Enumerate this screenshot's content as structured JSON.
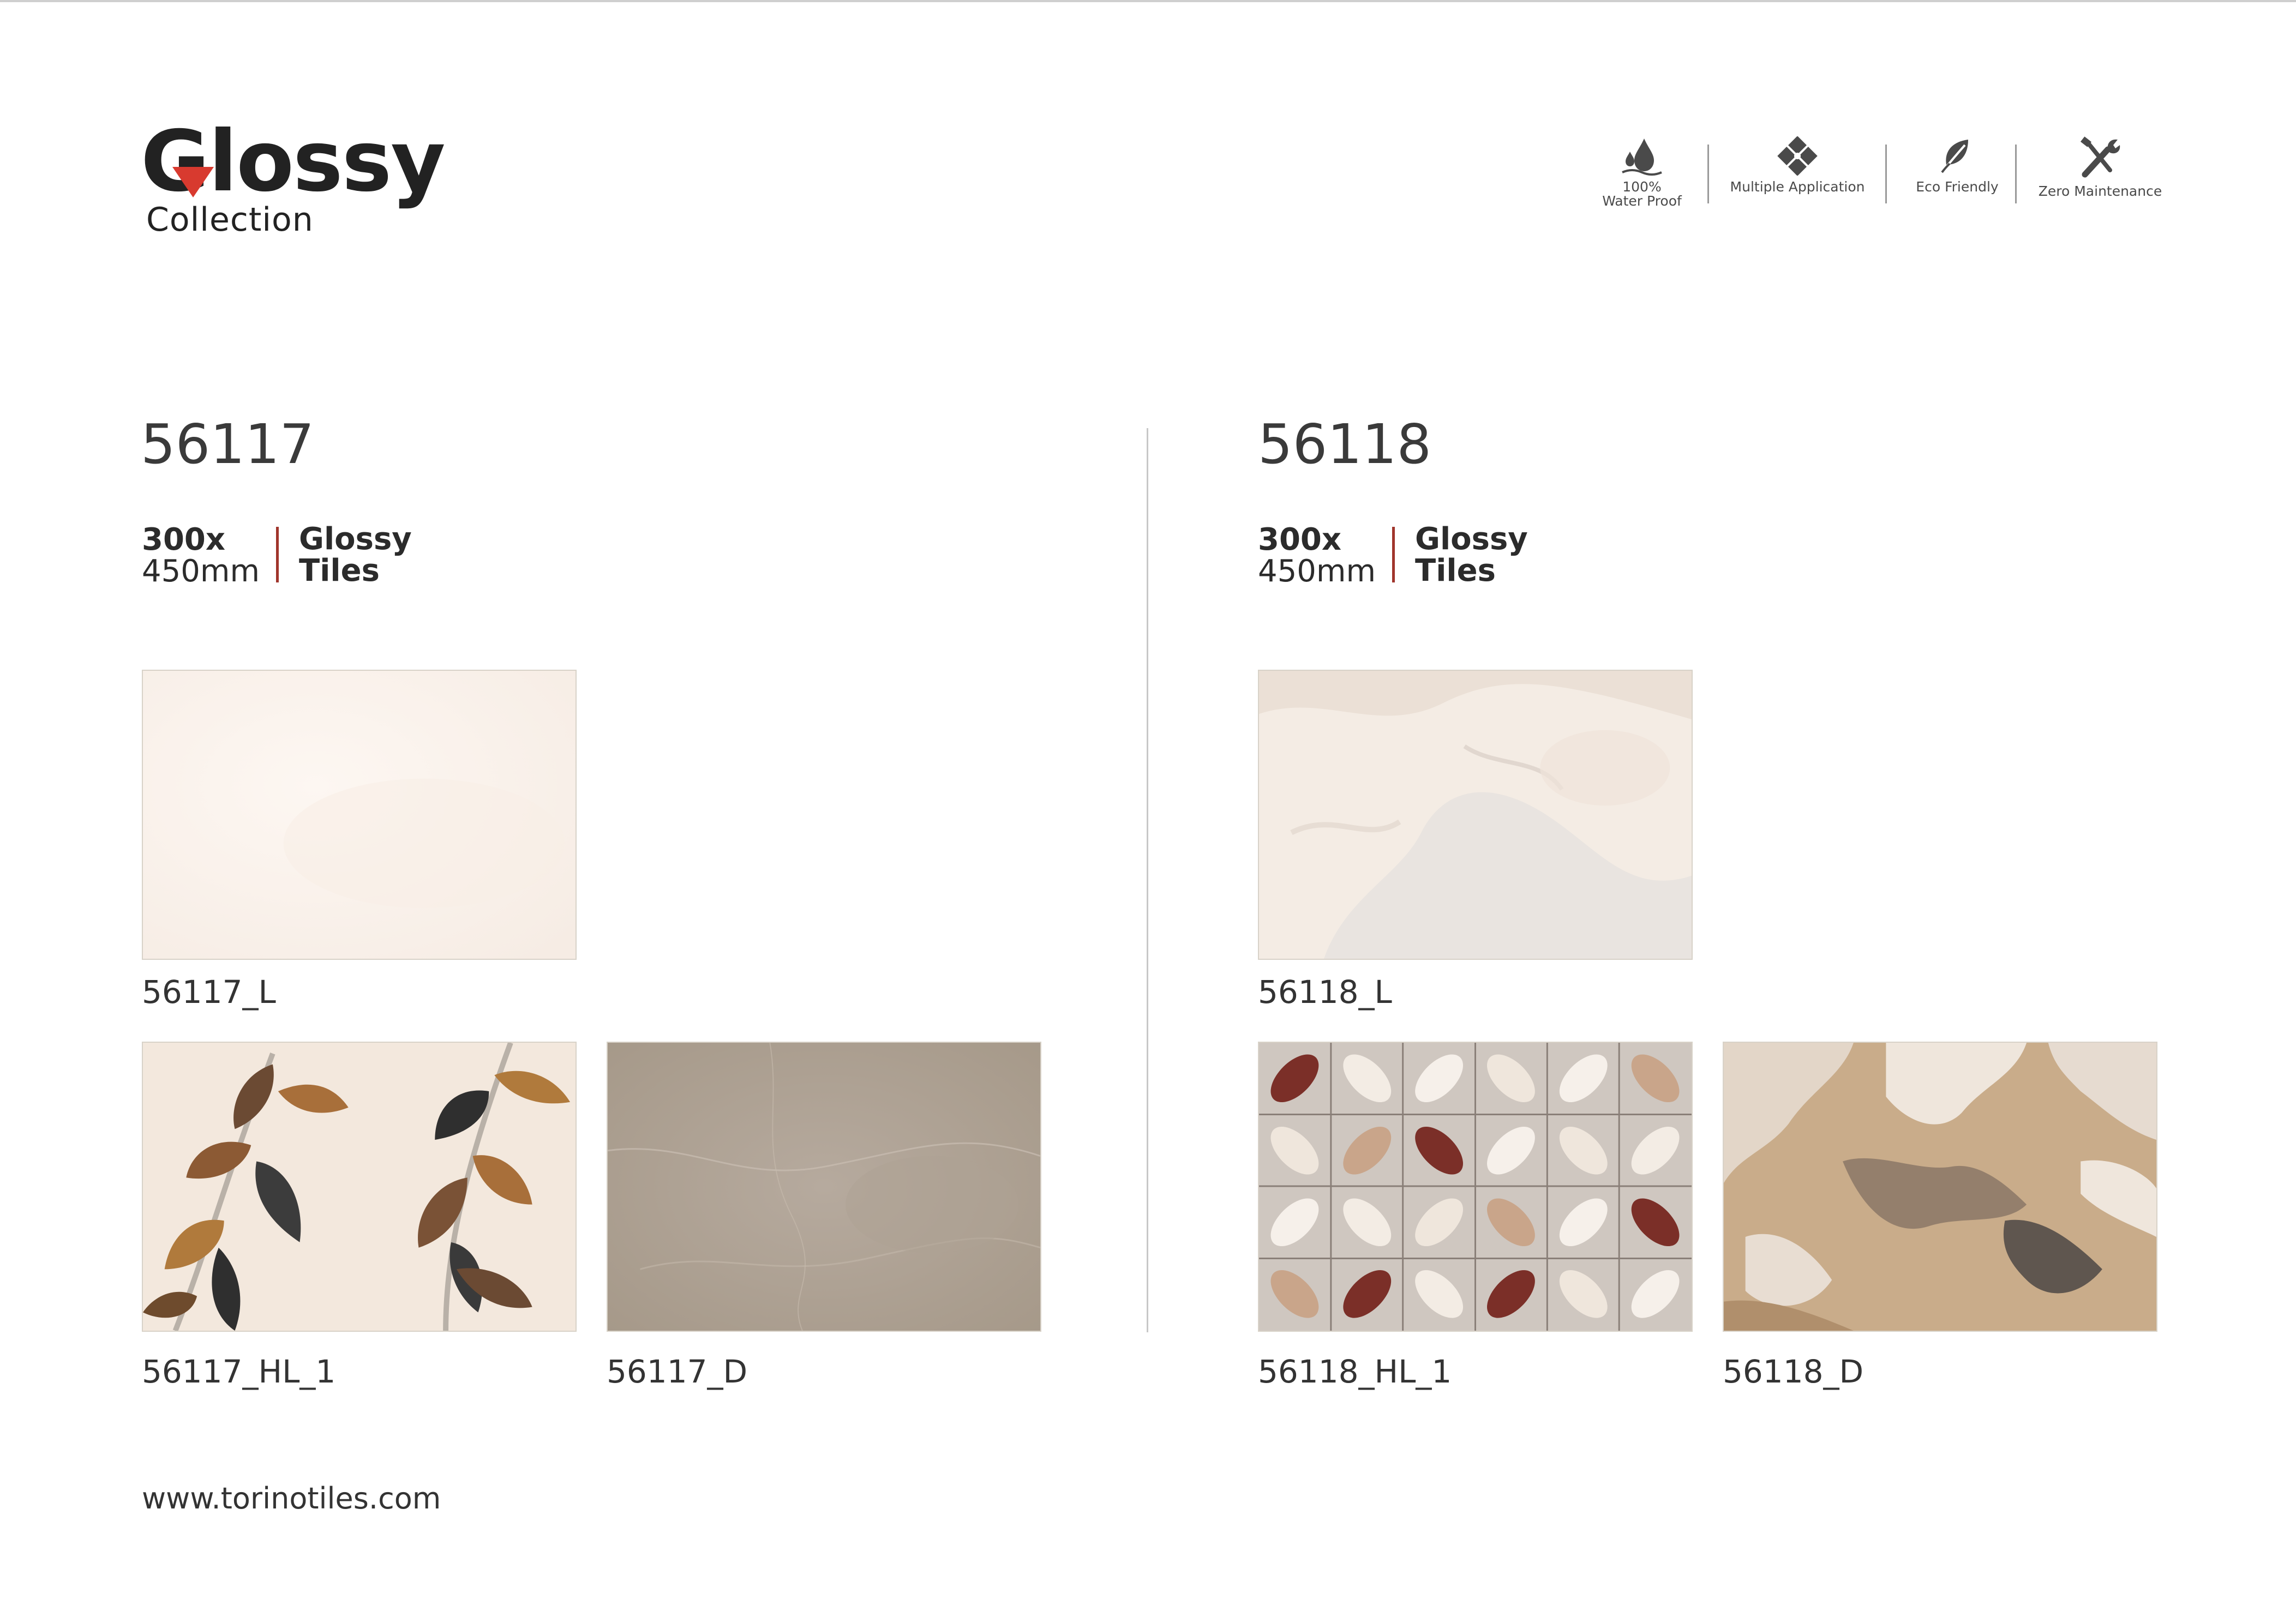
{
  "brand": {
    "name": "Glossy",
    "subtitle": "Collection"
  },
  "features": [
    {
      "icon": "water-drop-icon",
      "label_line1": "100%",
      "label_line2": "Water Proof"
    },
    {
      "icon": "multi-tile-icon",
      "label_line1": "",
      "label_line2": "Multiple Application"
    },
    {
      "icon": "leaf-icon",
      "label_line1": "",
      "label_line2": "Eco Friendly"
    },
    {
      "icon": "wrench-screwdriver-icon",
      "label_line1": "",
      "label_line2": "Zero Maintenance"
    }
  ],
  "products": [
    {
      "code": "56117",
      "size_line1": "300x",
      "size_line2": "450mm",
      "type_line1": "Glossy",
      "type_line2": "Tiles",
      "tiles": [
        {
          "label": "56117_L"
        },
        {
          "label": "56117_HL_1"
        },
        {
          "label": "56117_D"
        }
      ]
    },
    {
      "code": "56118",
      "size_line1": "300x",
      "size_line2": "450mm",
      "type_line1": "Glossy",
      "type_line2": "Tiles",
      "tiles": [
        {
          "label": "56118_L"
        },
        {
          "label": "56118_HL_1"
        },
        {
          "label": "56118_D"
        }
      ]
    }
  ],
  "footer": {
    "url": "www.torinotiles.com"
  },
  "colors": {
    "accent_red": "#d83a2f",
    "divider_red": "#a0352c"
  }
}
